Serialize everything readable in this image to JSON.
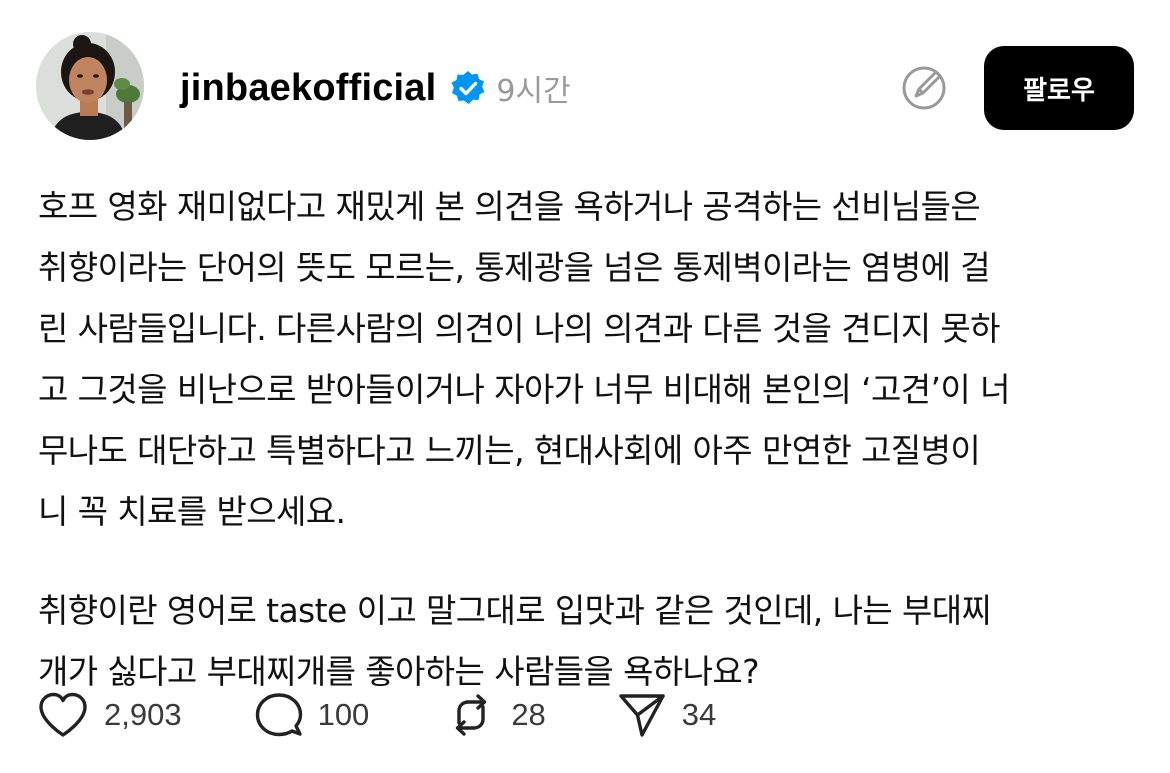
{
  "post": {
    "username": "jinbaekofficial",
    "time": "9시간",
    "follow_label": "팔로우",
    "body_lines": [
      "호프 영화 재미없다고 재밌게 본 의견을 욕하거나 공격하는 선비님들은",
      "취향이라는 단어의 뜻도 모르는, 통제광을 넘은 통제벽이라는 염병에 걸",
      "린 사람들입니다. 다른사람의 의견이 나의 의견과 다른 것을 견디지 못하",
      "고 그것을 비난으로 받아들이거나 자아가 너무 비대해 본인의 ‘고견’이 너",
      "무나도 대단하고 특별하다고 느끼는, 현대사회에 아주 만연한 고질병이",
      "니 꼭 치료를 받으세요.",
      "취향이란 영어로 taste 이고 말그대로 입맛과 같은 것인데, 나는 부대찌",
      "개가 싫다고 부대찌개를 좋아하는 사람들을 욕하나요?"
    ]
  },
  "actions": {
    "likes": "2,903",
    "comments": "100",
    "reposts": "28",
    "shares": "34"
  },
  "icons": {
    "verified": "verified-badge-icon",
    "edit": "edit-icon",
    "like": "heart-icon",
    "comment": "comment-icon",
    "repost": "repost-icon",
    "share": "send-icon"
  },
  "colors": {
    "verified": "#0095f6",
    "follow_bg": "#000000",
    "muted": "#9a9a9a"
  }
}
